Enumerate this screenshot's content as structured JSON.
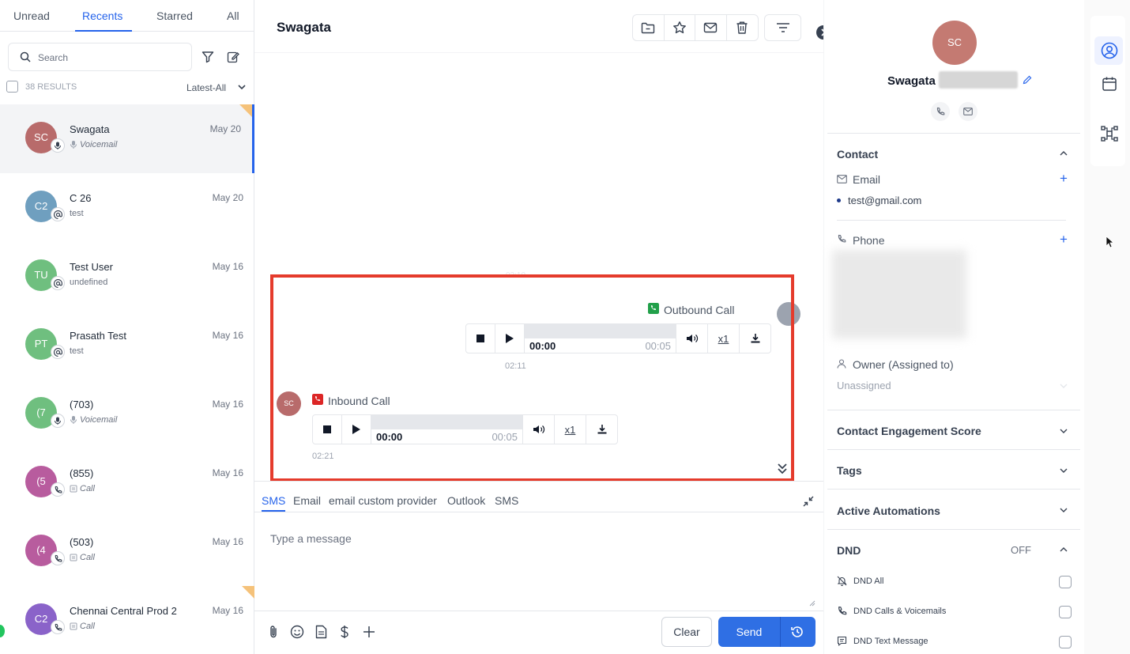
{
  "left": {
    "tabs": [
      "Unread",
      "Recents",
      "Starred",
      "All"
    ],
    "search_placeholder": "Search",
    "results": "38 RESULTS",
    "sort": "Latest-All",
    "conversations": [
      {
        "initials": "SC",
        "name": "Swagata",
        "sub": "Voicemail",
        "date": "May 20",
        "color": "#b86b6b",
        "badge": "mic-icon"
      },
      {
        "initials": "C2",
        "name": "C 26",
        "sub": "test",
        "date": "May 20",
        "color": "#6f9fbf",
        "badge": "at-icon"
      },
      {
        "initials": "TU",
        "name": "Test User",
        "sub": "undefined",
        "date": "May 16",
        "color": "#6fbf7f",
        "badge": "at-icon"
      },
      {
        "initials": "PT",
        "name": "Prasath Test",
        "sub": "test",
        "date": "May 16",
        "color": "#6fbf7f",
        "badge": "at-icon"
      },
      {
        "initials": "(7",
        "name": "(703)",
        "sub": "Voicemail",
        "date": "May 16",
        "color": "#6fbf7f",
        "badge": "mic-icon"
      },
      {
        "initials": "(5",
        "name": "(855)",
        "sub": "Call",
        "date": "May 16",
        "color": "#b85c9e",
        "badge": "phone-icon"
      },
      {
        "initials": "(4",
        "name": "(503)",
        "sub": "Call",
        "date": "May 16",
        "color": "#b85c9e",
        "badge": "phone-icon"
      },
      {
        "initials": "C2",
        "name": "Chennai Central Prod 2",
        "sub": "Call",
        "date": "May 16",
        "color": "#8a63c9",
        "badge": "phone-icon"
      }
    ]
  },
  "chat": {
    "title": "Swagata",
    "faint_time": "02:10",
    "outbound": {
      "label": "Outbound Call",
      "current": "00:00",
      "duration": "00:05",
      "speed": "x1",
      "time": "02:11"
    },
    "inbound": {
      "label": "Inbound Call",
      "current": "00:00",
      "duration": "00:05",
      "speed": "x1",
      "time": "02:21",
      "avatar": "SC"
    }
  },
  "composer": {
    "channels": [
      "SMS",
      "Email",
      "email custom provider",
      "Outlook",
      "SMS"
    ],
    "placeholder": "Type a message",
    "clear": "Clear",
    "send": "Send"
  },
  "contact": {
    "initials": "SC",
    "name": "Swagata",
    "section_contact": "Contact",
    "email_label": "Email",
    "email": "test@gmail.com",
    "phone_label": "Phone",
    "owner_label": "Owner (Assigned to)",
    "owner_value": "Unassigned",
    "engagement": "Contact Engagement Score",
    "tags": "Tags",
    "automations": "Active Automations",
    "dnd": "DND",
    "dnd_state": "OFF",
    "dnd_all": "DND All",
    "dnd_calls": "DND Calls & Voicemails",
    "dnd_text": "DND Text Message"
  },
  "colors": {
    "accent": "#2563eb",
    "highlight": "#e53b2c",
    "outbound_icon": "#22a04a",
    "inbound_icon": "#dc2626"
  }
}
